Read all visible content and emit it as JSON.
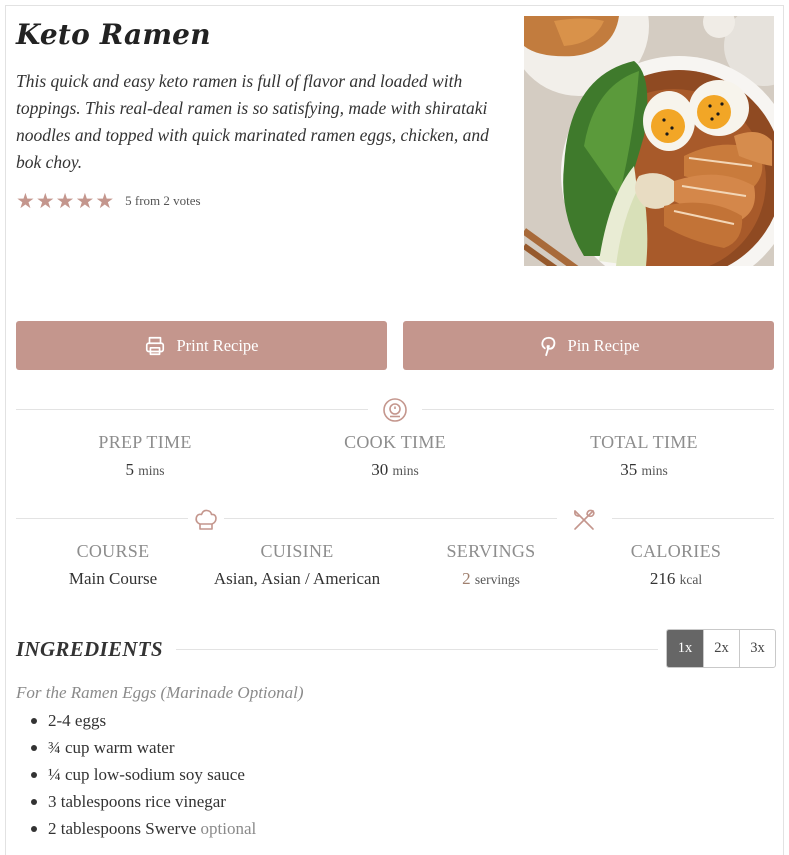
{
  "recipe": {
    "title": "Keto Ramen",
    "summary": "This quick and easy keto ramen is full of flavor and loaded with toppings. This real-deal ramen is so satisfying, made with shirataki noodles and topped with quick marinated ramen eggs, chicken, and bok choy.",
    "rating": {
      "stars": 5,
      "max": 5,
      "text": "5 from 2 votes",
      "color": "#c4968d"
    },
    "image_icon": "ramen-photo"
  },
  "buttons": {
    "print_label": "Print Recipe",
    "pin_label": "Pin Recipe",
    "color": "#c4968d"
  },
  "times": {
    "prep": {
      "label": "PREP TIME",
      "value": "5",
      "unit": "mins"
    },
    "cook": {
      "label": "COOK TIME",
      "value": "30",
      "unit": "mins"
    },
    "total": {
      "label": "TOTAL TIME",
      "value": "35",
      "unit": "mins"
    }
  },
  "details": {
    "course": {
      "label": "COURSE",
      "value": "Main Course"
    },
    "cuisine": {
      "label": "CUISINE",
      "value": "Asian, Asian / American"
    },
    "servings": {
      "label": "SERVINGS",
      "value": "2",
      "unit": "servings"
    },
    "calories": {
      "label": "CALORIES",
      "value": "216",
      "unit": "kcal"
    }
  },
  "ingredients": {
    "heading": "INGREDIENTS",
    "scale_options": [
      "1x",
      "2x",
      "3x"
    ],
    "selected_scale": "1x",
    "group_title": "For the Ramen Eggs (Marinade Optional)",
    "items": [
      {
        "text": "2-4 eggs",
        "note": ""
      },
      {
        "text": "¾ cup warm water",
        "note": ""
      },
      {
        "text": "¼ cup low-sodium soy sauce",
        "note": ""
      },
      {
        "text": "3 tablespoons rice vinegar",
        "note": ""
      },
      {
        "text": "2 tablespoons Swerve",
        "note": "optional"
      }
    ]
  }
}
